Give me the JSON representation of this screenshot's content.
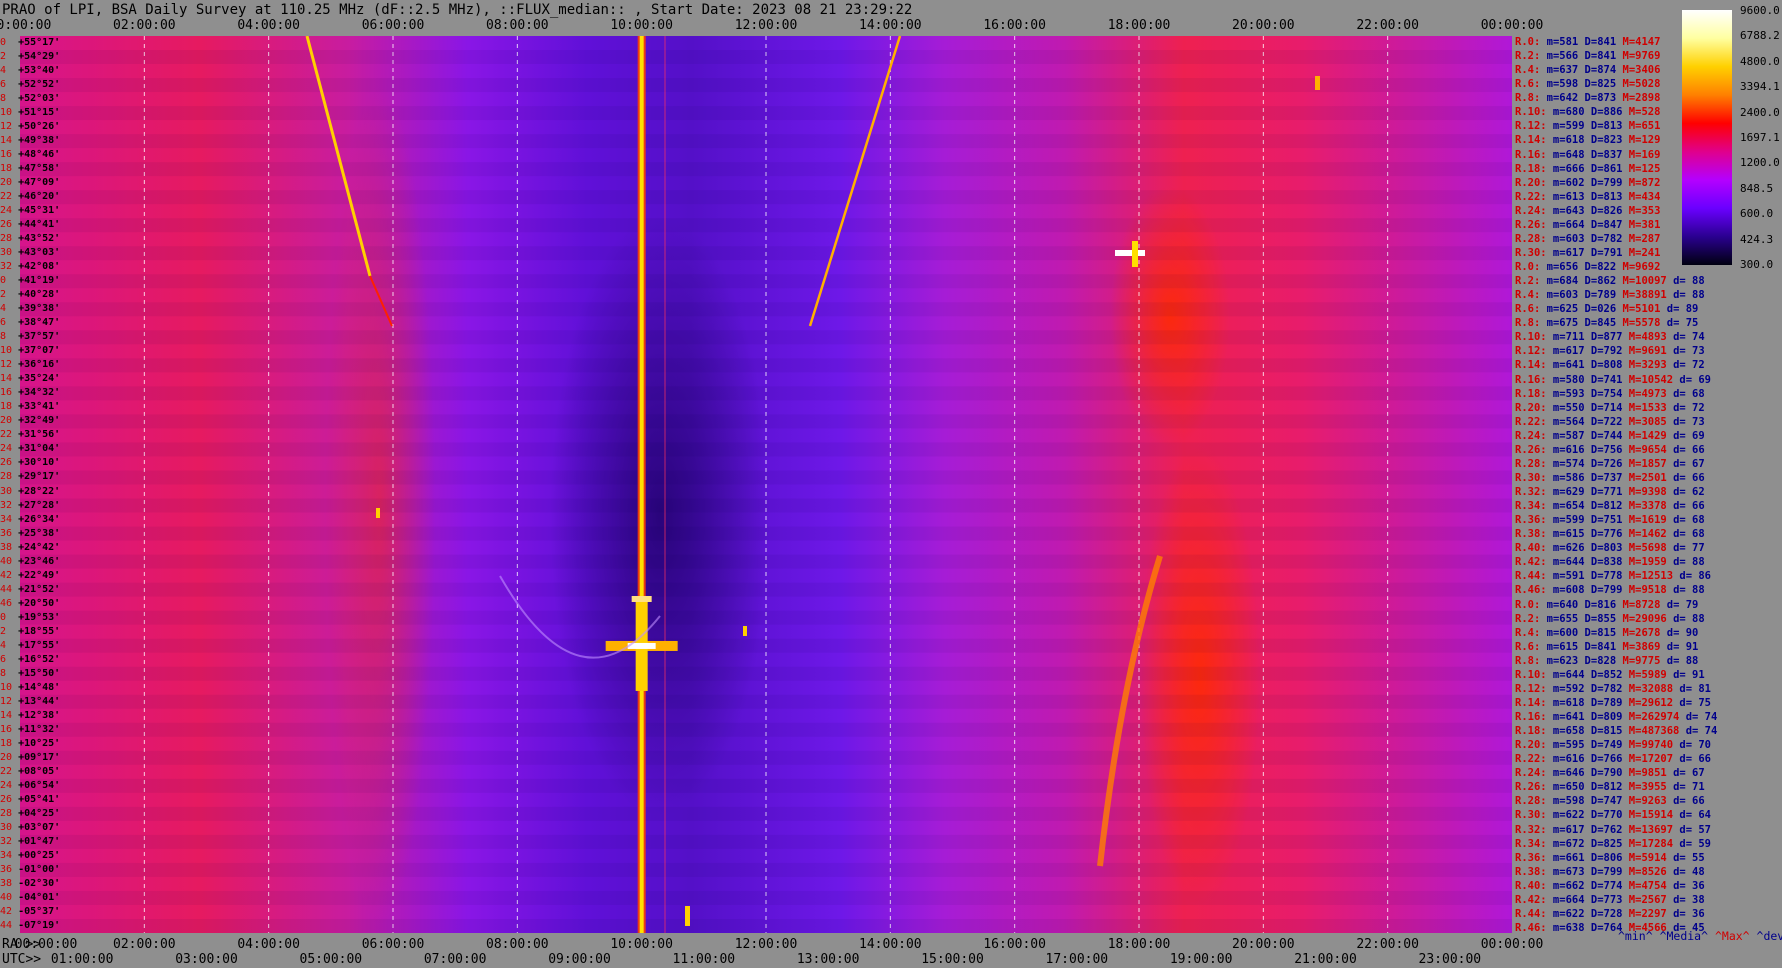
{
  "title": "PRAO of LPI, BSA Daily Survey at 110.25 MHz (dF::2.5 MHz), ::FLUX_median:: , Start Date: 2023 08 21 23:29:22",
  "chart_data": {
    "type": "heatmap",
    "title": "PRAO of LPI, BSA Daily Survey at 110.25 MHz (dF::2.5 MHz), ::FLUX_median:: , Start Date: 2023 08 21 23:29:22",
    "x_top_ticks": [
      "00:00:00",
      "02:00:00",
      "04:00:00",
      "06:00:00",
      "08:00:00",
      "10:00:00",
      "12:00:00",
      "14:00:00",
      "16:00:00",
      "18:00:00",
      "20:00:00",
      "22:00:00",
      "00:00:00"
    ],
    "x_bottom_ra_label": "RA >>",
    "x_bottom_ra_ticks": [
      "00:00:00",
      "02:00:00",
      "04:00:00",
      "06:00:00",
      "08:00:00",
      "10:00:00",
      "12:00:00",
      "14:00:00",
      "16:00:00",
      "18:00:00",
      "20:00:00",
      "22:00:00",
      "00:00:00"
    ],
    "x_bottom_utc_label": "UTC>>",
    "x_bottom_utc_ticks": [
      "01:00:00",
      "03:00:00",
      "05:00:00",
      "07:00:00",
      "09:00:00",
      "11:00:00",
      "13:00:00",
      "15:00:00",
      "17:00:00",
      "19:00:00",
      "21:00:00",
      "23:00:00"
    ],
    "rows": [
      {
        "n": "0",
        "dec": "+55°17'"
      },
      {
        "n": "2",
        "dec": "+54°29'"
      },
      {
        "n": "4",
        "dec": "+53°40'"
      },
      {
        "n": "6",
        "dec": "+52°52'"
      },
      {
        "n": "8",
        "dec": "+52°03'"
      },
      {
        "n": "10",
        "dec": "+51°15'"
      },
      {
        "n": "12",
        "dec": "+50°26'"
      },
      {
        "n": "14",
        "dec": "+49°38'"
      },
      {
        "n": "16",
        "dec": "+48°46'"
      },
      {
        "n": "18",
        "dec": "+47°58'"
      },
      {
        "n": "20",
        "dec": "+47°09'"
      },
      {
        "n": "22",
        "dec": "+46°20'"
      },
      {
        "n": "24",
        "dec": "+45°31'"
      },
      {
        "n": "26",
        "dec": "+44°41'"
      },
      {
        "n": "28",
        "dec": "+43°52'"
      },
      {
        "n": "30",
        "dec": "+43°03'"
      },
      {
        "n": "32",
        "dec": "+42°08'"
      },
      {
        "n": "0",
        "dec": "+41°19'"
      },
      {
        "n": "2",
        "dec": "+40°28'"
      },
      {
        "n": "4",
        "dec": "+39°38'"
      },
      {
        "n": "6",
        "dec": "+38°47'"
      },
      {
        "n": "8",
        "dec": "+37°57'"
      },
      {
        "n": "10",
        "dec": "+37°07'"
      },
      {
        "n": "12",
        "dec": "+36°16'"
      },
      {
        "n": "14",
        "dec": "+35°24'"
      },
      {
        "n": "16",
        "dec": "+34°32'"
      },
      {
        "n": "18",
        "dec": "+33°41'"
      },
      {
        "n": "20",
        "dec": "+32°49'"
      },
      {
        "n": "22",
        "dec": "+31°56'"
      },
      {
        "n": "24",
        "dec": "+31°04'"
      },
      {
        "n": "26",
        "dec": "+30°10'"
      },
      {
        "n": "28",
        "dec": "+29°17'"
      },
      {
        "n": "30",
        "dec": "+28°22'"
      },
      {
        "n": "32",
        "dec": "+27°28'"
      },
      {
        "n": "34",
        "dec": "+26°34'"
      },
      {
        "n": "36",
        "dec": "+25°38'"
      },
      {
        "n": "38",
        "dec": "+24°42'"
      },
      {
        "n": "40",
        "dec": "+23°46'"
      },
      {
        "n": "42",
        "dec": "+22°49'"
      },
      {
        "n": "44",
        "dec": "+21°52'"
      },
      {
        "n": "46",
        "dec": "+20°50'"
      },
      {
        "n": "0",
        "dec": "+19°53'"
      },
      {
        "n": "2",
        "dec": "+18°55'"
      },
      {
        "n": "4",
        "dec": "+17°55'"
      },
      {
        "n": "6",
        "dec": "+16°52'"
      },
      {
        "n": "8",
        "dec": "+15°50'"
      },
      {
        "n": "10",
        "dec": "+14°48'"
      },
      {
        "n": "12",
        "dec": "+13°44'"
      },
      {
        "n": "14",
        "dec": "+12°38'"
      },
      {
        "n": "16",
        "dec": "+11°32'"
      },
      {
        "n": "18",
        "dec": "+10°25'"
      },
      {
        "n": "20",
        "dec": "+09°17'"
      },
      {
        "n": "22",
        "dec": "+08°05'"
      },
      {
        "n": "24",
        "dec": "+06°54'"
      },
      {
        "n": "26",
        "dec": "+05°41'"
      },
      {
        "n": "28",
        "dec": "+04°25'"
      },
      {
        "n": "30",
        "dec": "+03°07'"
      },
      {
        "n": "32",
        "dec": "+01°47'"
      },
      {
        "n": "34",
        "dec": "+00°25'"
      },
      {
        "n": "36",
        "dec": "-01°00'"
      },
      {
        "n": "38",
        "dec": "-02°30'"
      },
      {
        "n": "40",
        "dec": "-04°01'"
      },
      {
        "n": "42",
        "dec": "-05°37'"
      },
      {
        "n": "44",
        "dec": "-07°19'"
      }
    ],
    "stats": [
      {
        "r": "R.0:",
        "m": "m=581",
        "d": "D=841",
        "x": "M=4147",
        "dv": ""
      },
      {
        "r": "R.2:",
        "m": "m=566",
        "d": "D=841",
        "x": "M=9769",
        "dv": ""
      },
      {
        "r": "R.4:",
        "m": "m=637",
        "d": "D=874",
        "x": "M=3406",
        "dv": ""
      },
      {
        "r": "R.6:",
        "m": "m=598",
        "d": "D=825",
        "x": "M=5028",
        "dv": ""
      },
      {
        "r": "R.8:",
        "m": "m=642",
        "d": "D=873",
        "x": "M=2898",
        "dv": ""
      },
      {
        "r": "R.10:",
        "m": "m=680",
        "d": "D=886",
        "x": "M=528",
        "dv": ""
      },
      {
        "r": "R.12:",
        "m": "m=599",
        "d": "D=813",
        "x": "M=651",
        "dv": ""
      },
      {
        "r": "R.14:",
        "m": "m=618",
        "d": "D=823",
        "x": "M=129",
        "dv": ""
      },
      {
        "r": "R.16:",
        "m": "m=648",
        "d": "D=837",
        "x": "M=169",
        "dv": ""
      },
      {
        "r": "R.18:",
        "m": "m=666",
        "d": "D=861",
        "x": "M=125",
        "dv": ""
      },
      {
        "r": "R.20:",
        "m": "m=602",
        "d": "D=799",
        "x": "M=872",
        "dv": ""
      },
      {
        "r": "R.22:",
        "m": "m=613",
        "d": "D=813",
        "x": "M=434",
        "dv": ""
      },
      {
        "r": "R.24:",
        "m": "m=643",
        "d": "D=826",
        "x": "M=353",
        "dv": ""
      },
      {
        "r": "R.26:",
        "m": "m=664",
        "d": "D=847",
        "x": "M=381",
        "dv": ""
      },
      {
        "r": "R.28:",
        "m": "m=603",
        "d": "D=782",
        "x": "M=287",
        "dv": ""
      },
      {
        "r": "R.30:",
        "m": "m=617",
        "d": "D=791",
        "x": "M=241",
        "dv": ""
      },
      {
        "r": "R.0:",
        "m": "m=656",
        "d": "D=822",
        "x": "M=9692",
        "dv": ""
      },
      {
        "r": "R.2:",
        "m": "m=684",
        "d": "D=862",
        "x": "M=10097",
        "dv": "d= 88"
      },
      {
        "r": "R.4:",
        "m": "m=603",
        "d": "D=789",
        "x": "M=38891",
        "dv": "d= 88"
      },
      {
        "r": "R.6:",
        "m": "m=625",
        "d": "D=026",
        "x": "M=5101",
        "dv": "d= 89"
      },
      {
        "r": "R.8:",
        "m": "m=675",
        "d": "D=845",
        "x": "M=5578",
        "dv": "d= 75"
      },
      {
        "r": "R.10:",
        "m": "m=711",
        "d": "D=877",
        "x": "M=4893",
        "dv": "d= 74"
      },
      {
        "r": "R.12:",
        "m": "m=617",
        "d": "D=792",
        "x": "M=9691",
        "dv": "d= 73"
      },
      {
        "r": "R.14:",
        "m": "m=641",
        "d": "D=808",
        "x": "M=3293",
        "dv": "d= 72"
      },
      {
        "r": "R.16:",
        "m": "m=580",
        "d": "D=741",
        "x": "M=10542",
        "dv": "d= 69"
      },
      {
        "r": "R.18:",
        "m": "m=593",
        "d": "D=754",
        "x": "M=4973",
        "dv": "d= 68"
      },
      {
        "r": "R.20:",
        "m": "m=550",
        "d": "D=714",
        "x": "M=1533",
        "dv": "d= 72"
      },
      {
        "r": "R.22:",
        "m": "m=564",
        "d": "D=722",
        "x": "M=3085",
        "dv": "d= 73"
      },
      {
        "r": "R.24:",
        "m": "m=587",
        "d": "D=744",
        "x": "M=1429",
        "dv": "d= 69"
      },
      {
        "r": "R.26:",
        "m": "m=616",
        "d": "D=756",
        "x": "M=9654",
        "dv": "d= 66"
      },
      {
        "r": "R.28:",
        "m": "m=574",
        "d": "D=726",
        "x": "M=1857",
        "dv": "d= 67"
      },
      {
        "r": "R.30:",
        "m": "m=586",
        "d": "D=737",
        "x": "M=2501",
        "dv": "d= 66"
      },
      {
        "r": "R.32:",
        "m": "m=629",
        "d": "D=771",
        "x": "M=9398",
        "dv": "d= 62"
      },
      {
        "r": "R.34:",
        "m": "m=654",
        "d": "D=812",
        "x": "M=3378",
        "dv": "d= 66"
      },
      {
        "r": "R.36:",
        "m": "m=599",
        "d": "D=751",
        "x": "M=1619",
        "dv": "d= 68"
      },
      {
        "r": "R.38:",
        "m": "m=615",
        "d": "D=776",
        "x": "M=1462",
        "dv": "d= 68"
      },
      {
        "r": "R.40:",
        "m": "m=626",
        "d": "D=803",
        "x": "M=5698",
        "dv": "d= 77"
      },
      {
        "r": "R.42:",
        "m": "m=644",
        "d": "D=838",
        "x": "M=1959",
        "dv": "d= 88"
      },
      {
        "r": "R.44:",
        "m": "m=591",
        "d": "D=778",
        "x": "M=12513",
        "dv": "d= 86"
      },
      {
        "r": "R.46:",
        "m": "m=608",
        "d": "D=799",
        "x": "M=9518",
        "dv": "d= 88"
      },
      {
        "r": "R.0:",
        "m": "m=640",
        "d": "D=816",
        "x": "M=8728",
        "dv": "d= 79"
      },
      {
        "r": "R.2:",
        "m": "m=655",
        "d": "D=855",
        "x": "M=29096",
        "dv": "d= 88"
      },
      {
        "r": "R.4:",
        "m": "m=600",
        "d": "D=815",
        "x": "M=2678",
        "dv": "d= 90"
      },
      {
        "r": "R.6:",
        "m": "m=615",
        "d": "D=841",
        "x": "M=3869",
        "dv": "d= 91"
      },
      {
        "r": "R.8:",
        "m": "m=623",
        "d": "D=828",
        "x": "M=9775",
        "dv": "d= 88"
      },
      {
        "r": "R.10:",
        "m": "m=644",
        "d": "D=852",
        "x": "M=5989",
        "dv": "d= 91"
      },
      {
        "r": "R.12:",
        "m": "m=592",
        "d": "D=782",
        "x": "M=32088",
        "dv": "d= 81"
      },
      {
        "r": "R.14:",
        "m": "m=618",
        "d": "D=789",
        "x": "M=29612",
        "dv": "d= 75"
      },
      {
        "r": "R.16:",
        "m": "m=641",
        "d": "D=809",
        "x": "M=262974",
        "dv": "d= 74"
      },
      {
        "r": "R.18:",
        "m": "m=658",
        "d": "D=815",
        "x": "M=487368",
        "dv": "d= 74"
      },
      {
        "r": "R.20:",
        "m": "m=595",
        "d": "D=749",
        "x": "M=99740",
        "dv": "d= 70"
      },
      {
        "r": "R.22:",
        "m": "m=616",
        "d": "D=766",
        "x": "M=17207",
        "dv": "d= 66"
      },
      {
        "r": "R.24:",
        "m": "m=646",
        "d": "D=790",
        "x": "M=9851",
        "dv": "d= 67"
      },
      {
        "r": "R.26:",
        "m": "m=650",
        "d": "D=812",
        "x": "M=3955",
        "dv": "d= 71"
      },
      {
        "r": "R.28:",
        "m": "m=598",
        "d": "D=747",
        "x": "M=9263",
        "dv": "d= 66"
      },
      {
        "r": "R.30:",
        "m": "m=622",
        "d": "D=770",
        "x": "M=15914",
        "dv": "d= 64"
      },
      {
        "r": "R.32:",
        "m": "m=617",
        "d": "D=762",
        "x": "M=13697",
        "dv": "d= 57"
      },
      {
        "r": "R.34:",
        "m": "m=672",
        "d": "D=825",
        "x": "M=17284",
        "dv": "d= 59"
      },
      {
        "r": "R.36:",
        "m": "m=661",
        "d": "D=806",
        "x": "M=5914",
        "dv": "d= 55"
      },
      {
        "r": "R.38:",
        "m": "m=673",
        "d": "D=799",
        "x": "M=8526",
        "dv": "d= 48"
      },
      {
        "r": "R.40:",
        "m": "m=662",
        "d": "D=774",
        "x": "M=4754",
        "dv": "d= 36"
      },
      {
        "r": "R.42:",
        "m": "m=664",
        "d": "D=773",
        "x": "M=2567",
        "dv": "d= 38"
      },
      {
        "r": "R.44:",
        "m": "m=622",
        "d": "D=728",
        "x": "M=2297",
        "dv": "d= 36"
      },
      {
        "r": "R.46:",
        "m": "m=638",
        "d": "D=764",
        "x": "M=4566",
        "dv": "d= 45"
      }
    ],
    "stats_legend": {
      "min": "^min^",
      "median": "^Media^",
      "max": "^Max^",
      "devia": "^devia^"
    },
    "colorbar_ticks": [
      "9600.0",
      "6788.2",
      "4800.0",
      "3394.1",
      "2400.0",
      "1697.1",
      "1200.0",
      "848.5",
      "600.0",
      "424.3",
      "300.0"
    ],
    "colorbar_colors": [
      "#ffffff",
      "#ffffa0",
      "#ffd000",
      "#ff8000",
      "#ff0000",
      "#e0008c",
      "#b400ff",
      "#6a00ff",
      "#2a0090",
      "#000010"
    ],
    "features": [
      {
        "desc": "radio source transit",
        "ra_hours": 10.0,
        "color": "#ffe000"
      },
      {
        "desc": "bright source",
        "ra_hours": 10.0,
        "dec": "+11°32'",
        "color": "#ffffff"
      },
      {
        "desc": "galactic plane",
        "ra_hours": 20.0,
        "color": "#ff2000"
      }
    ],
    "xlabel": "",
    "ylabel": ""
  }
}
